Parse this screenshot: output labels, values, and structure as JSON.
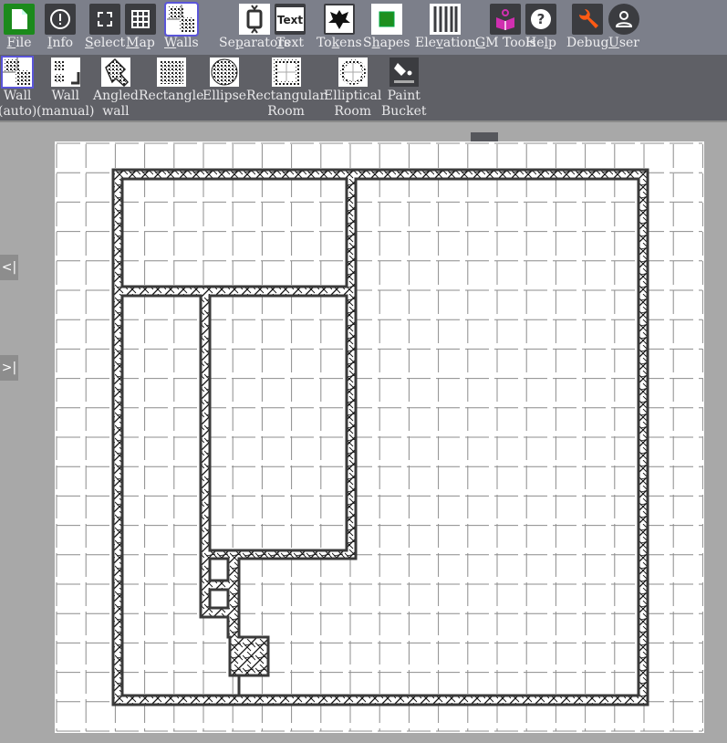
{
  "main_toolbar": {
    "items": [
      {
        "id": "file",
        "label": "File",
        "accel": "F",
        "icon": "file-icon",
        "color": "#1b8a1b"
      },
      {
        "id": "info",
        "label": "Info",
        "accel": "I",
        "icon": "info-icon"
      },
      {
        "id": "select",
        "label": "Select",
        "accel": "S",
        "icon": "select-icon"
      },
      {
        "id": "map",
        "label": "Map",
        "accel": "M",
        "icon": "grid-icon"
      },
      {
        "id": "walls",
        "label": "Walls",
        "accel": "W",
        "icon": "walls-icon",
        "selected": true
      },
      {
        "id": "separators",
        "label": "Separators",
        "accel": "p",
        "icon": "door-icon"
      },
      {
        "id": "text",
        "label": "Text",
        "accel": "T",
        "icon": "text-icon",
        "icon_text": "Text"
      },
      {
        "id": "tokens",
        "label": "Tokens",
        "accel": "k",
        "icon": "dragon-icon"
      },
      {
        "id": "shapes",
        "label": "Shapes",
        "accel": "h",
        "icon": "shapes-icon",
        "color": "#1f8f1f"
      },
      {
        "id": "elevation",
        "label": "Elevation",
        "accel": "v",
        "icon": "elevation-icon"
      },
      {
        "id": "gm_tools",
        "label": "GM Tools",
        "accel": "G",
        "icon": "book-icon",
        "color": "#d02fb0"
      },
      {
        "id": "help",
        "label": "Help",
        "accel": "l",
        "icon": "help-icon"
      },
      {
        "id": "debug",
        "label": "Debug",
        "accel": "",
        "icon": "wrench-icon",
        "color": "#ff5a14"
      },
      {
        "id": "user",
        "label": "User",
        "accel": "U",
        "icon": "user-icon"
      }
    ]
  },
  "wall_toolbar": {
    "items": [
      {
        "id": "wall_auto",
        "label": [
          "Wall",
          "(auto)"
        ],
        "icon": "wall-auto-icon",
        "selected": true
      },
      {
        "id": "wall_manual",
        "label": [
          "Wall",
          "(manual)"
        ],
        "icon": "wall-manual-icon"
      },
      {
        "id": "angled_wall",
        "label": [
          "Angled",
          "wall"
        ],
        "icon": "angled-wall-icon"
      },
      {
        "id": "rectangle",
        "label": [
          "Rectangle"
        ],
        "icon": "rectangle-icon"
      },
      {
        "id": "ellipse",
        "label": [
          "Ellipse"
        ],
        "icon": "ellipse-icon"
      },
      {
        "id": "rect_room",
        "label": [
          "Rectangular",
          "Room"
        ],
        "icon": "rectangular-room-icon"
      },
      {
        "id": "ellip_room",
        "label": [
          "Elliptical",
          "Room"
        ],
        "icon": "elliptical-room-icon"
      },
      {
        "id": "paint_bucket",
        "label": [
          "Paint",
          "Bucket"
        ],
        "icon": "paint-bucket-icon"
      }
    ],
    "collapse_icon": "chevron-down-icon"
  },
  "side_buttons": {
    "collapse_left": "<|",
    "expand_right": ">|"
  },
  "colors": {
    "toolbar_bg": "#7c7f8a",
    "subtoolbar_bg": "#5f6066",
    "canvas_bg": "#a8a8a8",
    "paper": "#ffffff",
    "grid": "#8c8c8c",
    "wall_outline": "#3a3a3a",
    "selection": "#5a55d8"
  }
}
